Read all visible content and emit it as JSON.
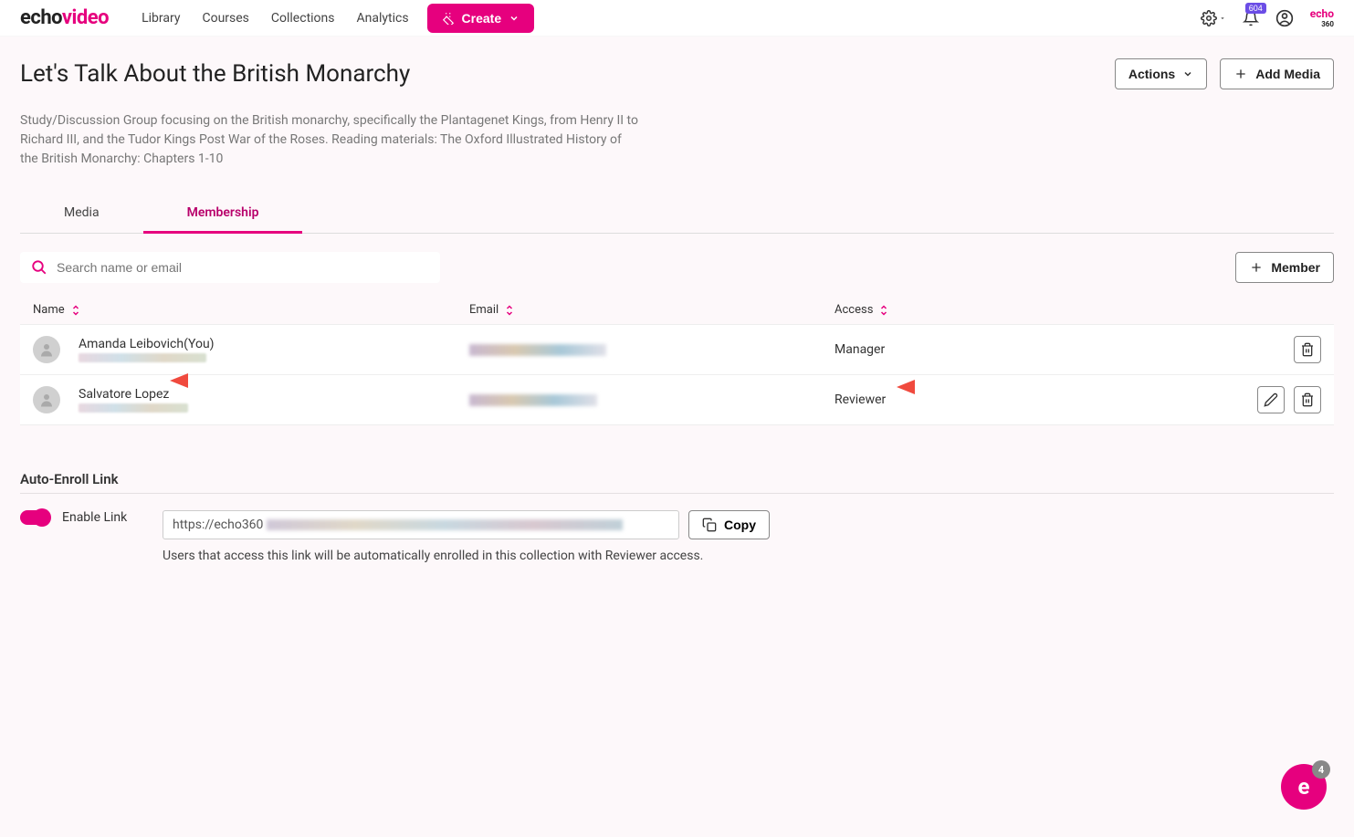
{
  "brand": {
    "part1": "echo",
    "part2": "video"
  },
  "nav": {
    "library": "Library",
    "courses": "Courses",
    "collections": "Collections",
    "analytics": "Analytics"
  },
  "create_label": "Create",
  "notifications_count": "604",
  "page": {
    "title": "Let's Talk About the British Monarchy",
    "description": "Study/Discussion Group focusing on the British monarchy, specifically the Plantagenet Kings, from Henry II to Richard III, and the Tudor Kings Post War of the Roses. Reading materials: The Oxford Illustrated History of the British Monarchy: Chapters 1-10"
  },
  "actions": {
    "actions_label": "Actions",
    "add_media_label": "Add Media"
  },
  "tabs": {
    "media": "Media",
    "membership": "Membership"
  },
  "search": {
    "placeholder": "Search name or email"
  },
  "member_button": "Member",
  "table": {
    "headers": {
      "name": "Name",
      "email": "Email",
      "access": "Access"
    },
    "rows": [
      {
        "name": "Amanda Leibovich(You)",
        "access": "Manager"
      },
      {
        "name": "Salvatore Lopez",
        "access": "Reviewer"
      }
    ]
  },
  "auto_enroll": {
    "title": "Auto-Enroll Link",
    "enable_label": "Enable Link",
    "link_prefix": "https://echo360",
    "copy_label": "Copy",
    "hint": "Users that access this link will be automatically enrolled in this collection with Reviewer access."
  },
  "fab_count": "4"
}
